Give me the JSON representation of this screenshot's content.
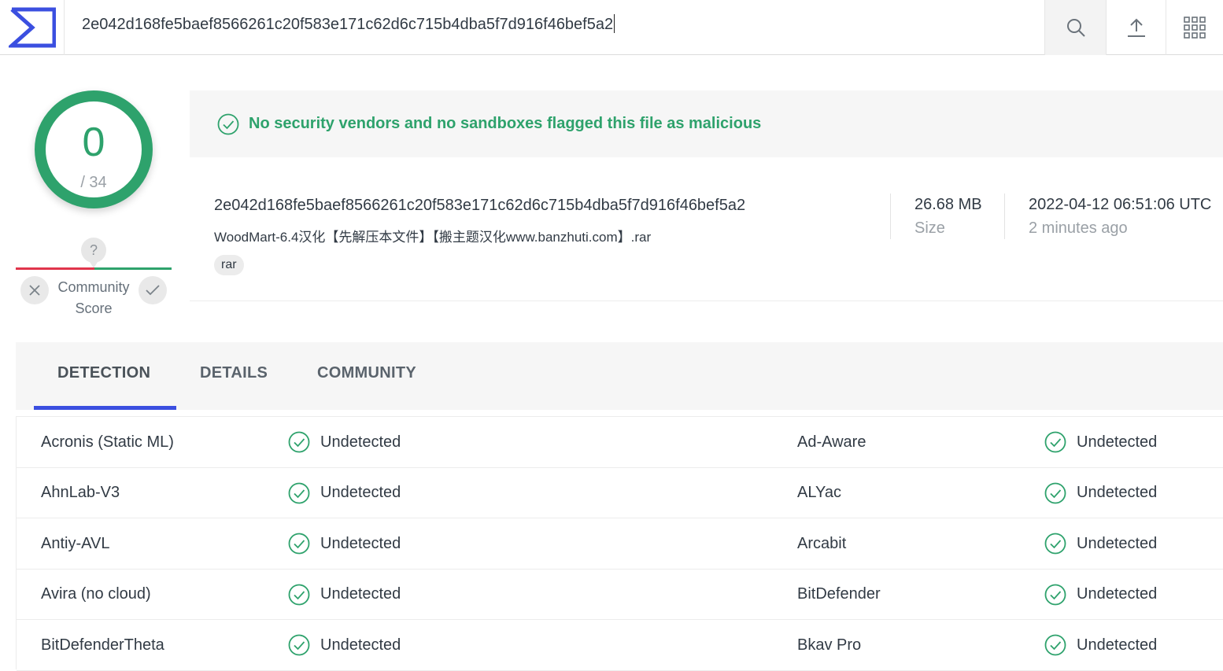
{
  "header": {
    "search_value": "2e042d168fe5baef8566261c20f583e171c62d6c715b4dba5f7d916f46bef5a2",
    "logo_icon": "sigma-logo-icon",
    "buttons": [
      "search-icon",
      "upload-icon",
      "apps-grid-icon"
    ],
    "accent_color": "#3b4fe0"
  },
  "score": {
    "detections": "0",
    "total": "/ 34",
    "color": "#2ea26c"
  },
  "community": {
    "unknown_glyph": "?",
    "label_line1": "Community",
    "label_line2": "Score"
  },
  "banner": {
    "message": "No security vendors and no sandboxes flagged this file as malicious"
  },
  "file": {
    "hash": "2e042d168fe5baef8566261c20f583e171c62d6c715b4dba5f7d916f46bef5a2",
    "name": "WoodMart-6.4汉化【先解压本文件】【搬主题汉化www.banzhuti.com】.rar",
    "tag": "rar",
    "size_value": "26.68 MB",
    "size_label": "Size",
    "date_value": "2022-04-12 06:51:06 UTC",
    "date_relative": "2 minutes ago"
  },
  "tabs": [
    {
      "label": "DETECTION",
      "active": true
    },
    {
      "label": "DETAILS",
      "active": false
    },
    {
      "label": "COMMUNITY",
      "active": false
    }
  ],
  "detections": [
    {
      "vendor1": "Acronis (Static ML)",
      "result1": "Undetected",
      "vendor2": "Ad-Aware",
      "result2": "Undetected"
    },
    {
      "vendor1": "AhnLab-V3",
      "result1": "Undetected",
      "vendor2": "ALYac",
      "result2": "Undetected"
    },
    {
      "vendor1": "Antiy-AVL",
      "result1": "Undetected",
      "vendor2": "Arcabit",
      "result2": "Undetected"
    },
    {
      "vendor1": "Avira (no cloud)",
      "result1": "Undetected",
      "vendor2": "BitDefender",
      "result2": "Undetected"
    },
    {
      "vendor1": "BitDefenderTheta",
      "result1": "Undetected",
      "vendor2": "Bkav Pro",
      "result2": "Undetected"
    }
  ]
}
